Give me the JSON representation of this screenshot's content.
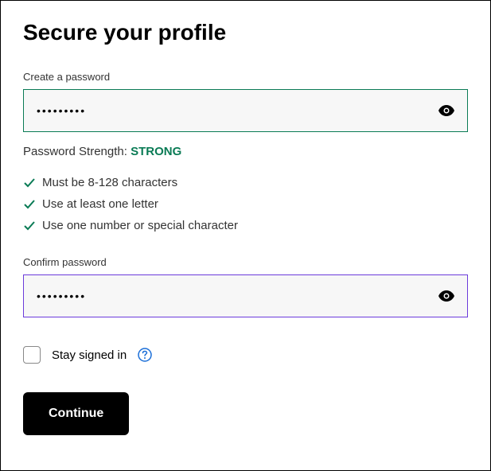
{
  "title": "Secure your profile",
  "create_password": {
    "label": "Create a password",
    "value": "•••••••••"
  },
  "strength": {
    "label": "Password Strength: ",
    "value": "STRONG"
  },
  "requirements": {
    "r1": "Must be 8-128 characters",
    "r2": "Use at least one letter",
    "r3": "Use one number or special character"
  },
  "confirm_password": {
    "label": "Confirm password",
    "value": "•••••••••"
  },
  "stay_signed_in": {
    "label": "Stay signed in"
  },
  "continue_label": "Continue"
}
